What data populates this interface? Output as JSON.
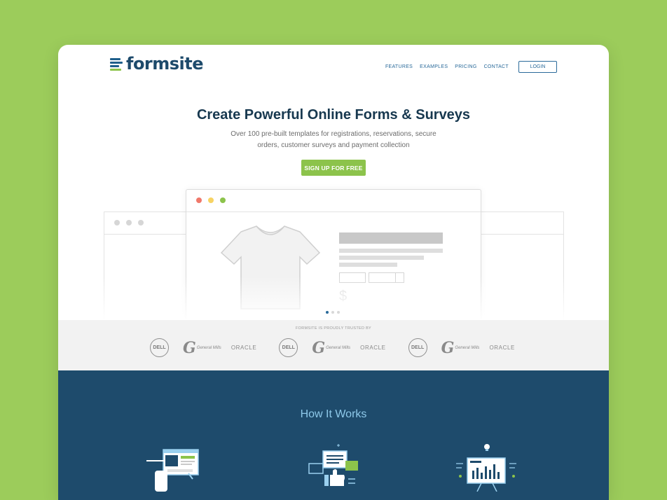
{
  "brand": {
    "name": "formsite"
  },
  "nav": {
    "items": [
      "FEATURES",
      "EXAMPLES",
      "PRICING",
      "CONTACT"
    ],
    "login_label": "LOGIN"
  },
  "hero": {
    "title": "Create Powerful Online Forms & Surveys",
    "subtitle_line1": "Over 100 pre-built templates for registrations, reservations, secure",
    "subtitle_line2": "orders, customer surveys and payment collection",
    "cta_label": "SIGN UP FOR FREE"
  },
  "preview": {
    "price_symbol": "$",
    "window_dots": [
      "#f0786a",
      "#f7d363",
      "#8cc34b"
    ],
    "carousel": {
      "count": 3,
      "active": 0
    }
  },
  "trusted": {
    "label": "FORMSITE IS PROUDLY TRUSTED BY",
    "logos": [
      {
        "dell": "DELL",
        "gm_text": "General Mills",
        "oracle": "ORACLE"
      },
      {
        "dell": "DELL",
        "gm_text": "General Mills",
        "oracle": "ORACLE"
      },
      {
        "dell": "DELL",
        "gm_text": "General Mills",
        "oracle": "ORACLE"
      }
    ]
  },
  "how_it_works": {
    "title": "How It Works",
    "steps": [
      "build-form-icon",
      "share-feedback-icon",
      "analyze-results-icon"
    ]
  },
  "colors": {
    "background": "#9ccc5b",
    "brand_navy": "#1d4a6b",
    "accent_green": "#8cc34b",
    "how_band": "#1e4b6c"
  }
}
